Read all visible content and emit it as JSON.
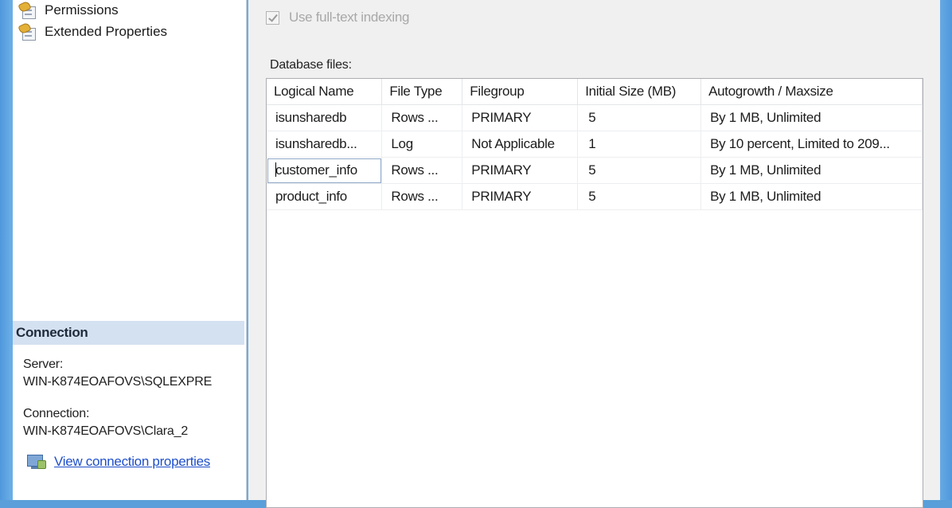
{
  "nav": {
    "pages": [
      {
        "label": "Permissions",
        "icon": "page-wrench-icon"
      },
      {
        "label": "Extended Properties",
        "icon": "page-wrench-icon"
      }
    ]
  },
  "connection": {
    "header": "Connection",
    "server_label": "Server:",
    "server_value": "WIN-K874EOAFOVS\\SQLEXPRE",
    "connection_label": "Connection:",
    "connection_value": "WIN-K874EOAFOVS\\Clara_2",
    "view_link": "View connection properties"
  },
  "options": {
    "fulltext_label": "Use full-text indexing",
    "fulltext_checked": true
  },
  "files": {
    "label": "Database files:",
    "columns": [
      "Logical Name",
      "File Type",
      "Filegroup",
      "Initial Size (MB)",
      "Autogrowth / Maxsize"
    ],
    "rows": [
      [
        "isunsharedb",
        "Rows ...",
        "PRIMARY",
        "5",
        "By 1 MB, Unlimited"
      ],
      [
        "isunsharedb...",
        "Log",
        "Not Applicable",
        "1",
        "By 10 percent, Limited to 209..."
      ],
      [
        "customer_info",
        "Rows ...",
        "PRIMARY",
        "5",
        "By 1 MB, Unlimited"
      ],
      [
        "product_info",
        "Rows ...",
        "PRIMARY",
        "5",
        "By 1 MB, Unlimited"
      ]
    ]
  },
  "colors": {
    "link": "#1f4fc9",
    "connection_header_bg": "#d4e1f1",
    "window_border": "#6aaee6"
  }
}
